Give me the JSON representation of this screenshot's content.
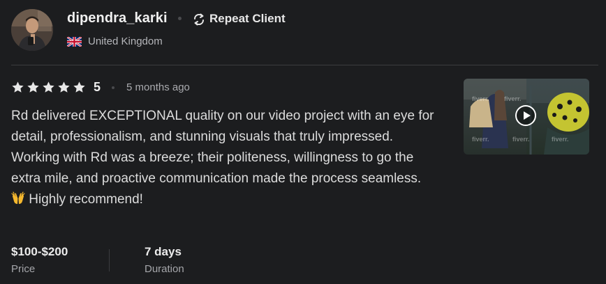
{
  "reviewer": {
    "username": "dipendra_karki",
    "badge_label": "Repeat Client",
    "badge_icon": "repeat-icon",
    "country": "United Kingdom",
    "flag_icon": "uk-flag-icon",
    "avatar_icon": "avatar"
  },
  "review": {
    "rating": 5,
    "rating_label": "5",
    "star_color": "#e8e8e8",
    "time_ago": "5 months ago",
    "text_before_emoji": "Rd delivered EXCEPTIONAL quality on our video project with an eye for detail, professionalism, and stunning visuals that truly impressed. Working with Rd was a breeze; their politeness, willingness to go the extra mile, and proactive communication made the process seamless. ",
    "emoji_icon": "raising-hands-icon",
    "text_after_emoji": " Highly recommend!"
  },
  "media": {
    "type": "video",
    "play_icon": "play-icon",
    "watermark_text": "fiverr."
  },
  "details": {
    "price_value": "$100-$200",
    "price_label": "Price",
    "duration_value": "7 days",
    "duration_label": "Duration"
  },
  "colors": {
    "background": "#1c1d1f",
    "divider": "#3b3c3f",
    "muted_text": "#a9aaae"
  }
}
